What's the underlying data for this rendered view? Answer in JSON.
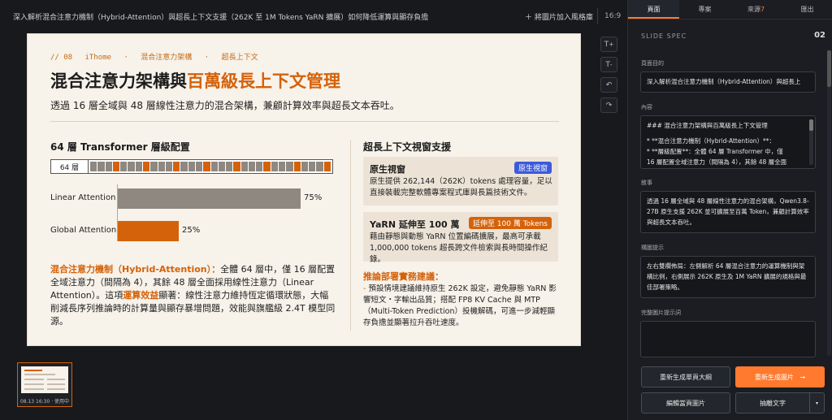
{
  "topbar": {
    "title": "深入解析混合注意力機制（Hybrid-Attention）與超長上下文支援（262K 至 1M Tokens YaRN 擴展）如何降低運算與顯存負擔",
    "fit_label": "＋ 將圖片加入風格庫",
    "ratio": "16:9"
  },
  "slide": {
    "kicker": [
      "// 08",
      "iThome",
      "·",
      "混合注意力架構",
      "·",
      "超長上下文"
    ],
    "title_part1": "混合注意力架構與",
    "title_part2": "百萬級長上下文管理",
    "subtitle": "透過 16 層全域與 48 層線性注意力的混合架構，兼顧計算效率與超長文本吞吐。",
    "left_title": "64 層 Transformer 層級配置",
    "layer_label": "64 層",
    "layer_pattern": [
      0,
      0,
      0,
      1,
      0,
      0,
      0,
      1,
      0,
      0,
      0,
      1,
      0,
      0,
      0,
      1,
      0,
      0,
      0,
      1,
      0,
      0,
      0,
      1,
      0,
      0,
      0,
      1,
      0,
      0,
      0,
      1
    ],
    "accent_color": "#d4620a",
    "linear_color": "#8f8880",
    "para_highlight": "混合注意力機制（Hybrid-Attention）：",
    "para_text1": "全體 64 層中，僅 16 層配置全域注意力（間隔為 4），其餘 48 層全面採用線性注意力（Linear Attention）。這項",
    "para_highlight2": "運算效益",
    "para_text2": "顯著：線性注意力維持恆定循環狀態，大幅削減長序列推論時的計算量與顯存暴增問題，效能與旗艦級 2.4T 模型同源。",
    "right_title": "超長上下文視窗支援",
    "box1": {
      "title": "原生視窗",
      "badge": "原生視窗",
      "body": "原生提供 262,144（262K）tokens 處理容量，足以直接裝載完整軟體專案程式庫與長篇技術文件。",
      "badge_color": "#3b5bdb"
    },
    "box2": {
      "title": "YaRN 延伸至 100 萬",
      "badge": "延伸至 100 萬 Tokens",
      "body": "藉由靜態與動態 YaRN 位置編碼擴展，最高可承載 1,000,000 tokens 超長跨文件檢索與長時間操作紀錄。",
      "badge_color": "#d4620a"
    },
    "reco_title": "推論部署實務建議：",
    "reco_dash": "-",
    "reco_body": "預設情境建議維持原生 262K 設定，避免靜態 YaRN 影響短文・字輸出品質；搭配 FP8 KV Cache 與 MTP（Multi-Token Prediction）投機解碼，可進一步減輕顯存負擔並顯著拉升吞吐速度。"
  },
  "chart_data": {
    "type": "bar",
    "categories": [
      "Linear Attention",
      "Global Attention"
    ],
    "values": [
      75,
      25
    ],
    "value_labels": [
      "75%",
      "25%"
    ],
    "colors": [
      "#8f8880",
      "#d4620a"
    ],
    "xlim": [
      0,
      100
    ]
  },
  "tools": [
    "T+",
    "T-",
    "undo",
    "redo"
  ],
  "thumb": {
    "caption": "08.13 16:30 · 使用中"
  },
  "panel": {
    "tabs": [
      {
        "label": "頁面",
        "count": ""
      },
      {
        "label": "專案",
        "count": ""
      },
      {
        "label": "來源",
        "count": "7"
      },
      {
        "label": "匯出",
        "count": ""
      }
    ],
    "spec_label": "SLIDE SPEC",
    "spec_num": "02",
    "purpose_label": "頁面目的",
    "purpose_value": "深入解析混合注意力機制（Hybrid-Attention）與超長上",
    "content_label": "內容",
    "content_lines": [
      "### 混合注意力架構與百萬級長上下文管理",
      "",
      "* **混合注意力機制（Hybrid-Attention）**：",
      "  * **層級配置**：全體 64 層 Transformer 中，僅",
      "16 層配置全域注意力（間隔為 4），其餘 48 層全面"
    ],
    "narration_label": "敘事",
    "narration_value": "透過 16 層全域與 48 層線性注意力的混合架構，Qwen3.8-27B 原生支援 262K 並可擴展至百萬 Token，兼顧計算效率與超長文本吞吐。",
    "layout_label": "構圖提示",
    "layout_value": "左右雙欄佈局：左側解析 64 層混合注意力的運算機制與架構比例，右側展示 262K 原生及 1M YaRN 擴展的規格與最佳部署策略。",
    "image_prompt_label": "完整圖片提示詞",
    "image_prompt_value": "",
    "btn_regen_outline": "重新生成單頁大綱",
    "btn_regen_image": "重新生成圖片",
    "btn_regen_arrow": "→",
    "btn_edit_image": "編輯當頁圖片",
    "btn_extract": "抽離文字",
    "btn_extract_caret": "▾"
  }
}
